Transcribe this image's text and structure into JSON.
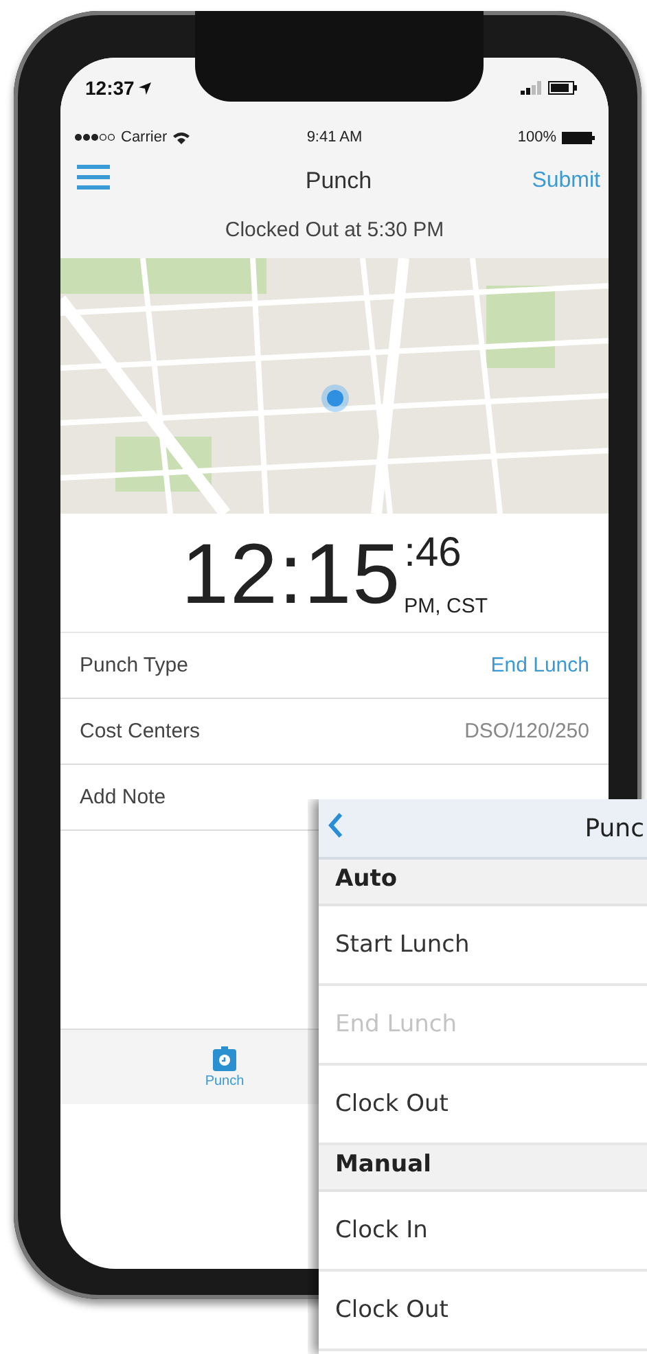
{
  "device_status_bar": {
    "time": "12:37"
  },
  "status_bar": {
    "carrier": "Carrier",
    "time": "9:41 AM",
    "battery": "100%"
  },
  "nav_bar": {
    "title": "Punch",
    "action": "Submit"
  },
  "status_message": "Clocked Out at 5:30 PM",
  "clock": {
    "time": "12:15",
    "seconds": ":46",
    "suffix": "PM, CST"
  },
  "fields": [
    {
      "label": "Punch Type",
      "value": "End Lunch",
      "kind": "link"
    },
    {
      "label": "Cost Centers",
      "value": "DSO/120/250",
      "kind": "text"
    },
    {
      "label": "Add Note"
    }
  ],
  "tab_bar": [
    {
      "label": "Punch",
      "selected": true
    }
  ],
  "punch_type_panel": {
    "title": "Punc",
    "sections": [
      {
        "title": "Auto",
        "items": [
          {
            "label": "Start Lunch",
            "disabled": false
          },
          {
            "label": "End Lunch",
            "disabled": true
          },
          {
            "label": "Clock Out",
            "disabled": false
          }
        ]
      },
      {
        "title": "Manual",
        "items": [
          {
            "label": "Clock In",
            "disabled": false
          },
          {
            "label": "Clock Out",
            "disabled": false
          }
        ]
      }
    ]
  }
}
